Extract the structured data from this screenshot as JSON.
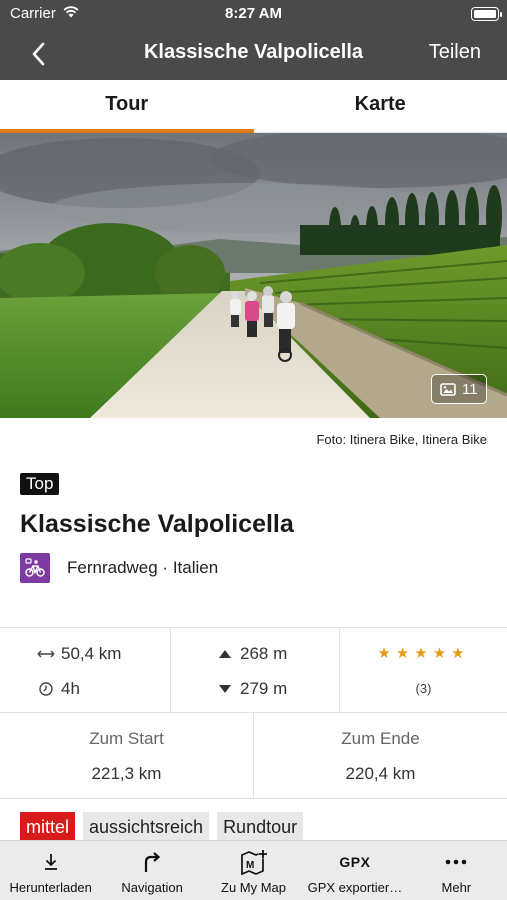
{
  "status_bar": {
    "carrier": "Carrier",
    "time": "8:27 AM"
  },
  "navbar": {
    "title": "Klassische Valpolicella",
    "share_label": "Teilen"
  },
  "tabs": [
    {
      "label": "Tour",
      "active": true
    },
    {
      "label": "Karte",
      "active": false
    }
  ],
  "hero": {
    "photo_count": "11"
  },
  "credit": "Foto: Itinera Bike, Itinera Bike",
  "badge": "Top",
  "tour": {
    "title": "Klassische Valpolicella",
    "category": "Fernradweg · Italien",
    "category_color": "#7d3aa0"
  },
  "stats": {
    "distance": "50,4 km",
    "duration": "4h",
    "ascent": "268 m",
    "descent": "279 m",
    "rating_stars": 5,
    "rating_count": "(3)"
  },
  "distances": {
    "start_label": "Zum Start",
    "start_value": "221,3 km",
    "end_label": "Zum Ende",
    "end_value": "220,4 km"
  },
  "tags": [
    {
      "label": "mittel",
      "color": "#d71a1a"
    },
    {
      "label": "aussichtsreich"
    },
    {
      "label": "Rundtour"
    }
  ],
  "toolbar": [
    {
      "label": "Herunterladen",
      "icon": "download-icon"
    },
    {
      "label": "Navigation",
      "icon": "turn-right-icon"
    },
    {
      "label": "Zu My Map",
      "icon": "map-add-icon"
    },
    {
      "label": "GPX exportier…",
      "icon": "gpx-icon",
      "icon_text": "GPX"
    },
    {
      "label": "Mehr",
      "icon": "more-icon"
    }
  ],
  "colors": {
    "bar": "#4a4a4a",
    "accent": "#e07b1a",
    "stars": "#e59a1a"
  }
}
